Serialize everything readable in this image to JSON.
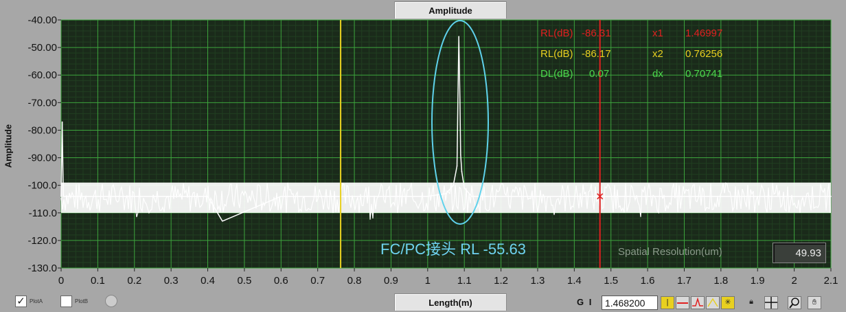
{
  "chart_data": {
    "type": "line",
    "title": "Amplitude",
    "xlabel": "Length(m)",
    "ylabel": "Amplitude",
    "xlim": [
      0,
      2.1
    ],
    "ylim": [
      -130,
      -40
    ],
    "x_ticks": [
      "0",
      "0.1",
      "0.2",
      "0.3",
      "0.4",
      "0.5",
      "0.6",
      "0.7",
      "0.8",
      "0.9",
      "1",
      "1.1",
      "1.2",
      "1.3",
      "1.4",
      "1.5",
      "1.6",
      "1.7",
      "1.8",
      "1.9",
      "2",
      "2.1"
    ],
    "x_tick_values": [
      0,
      0.1,
      0.2,
      0.3,
      0.4,
      0.5,
      0.6,
      0.7,
      0.8,
      0.9,
      1.0,
      1.1,
      1.2,
      1.3,
      1.4,
      1.5,
      1.6,
      1.7,
      1.8,
      1.9,
      2.0,
      2.1
    ],
    "y_ticks": [
      "-40.00",
      "-50.00",
      "-60.00",
      "-70.00",
      "-80.00",
      "-90.00",
      "-100.0",
      "-110.0",
      "-120.0",
      "-130.0"
    ],
    "y_tick_values": [
      -40,
      -50,
      -60,
      -70,
      -80,
      -90,
      -100,
      -110,
      -120,
      -130
    ],
    "grid": true,
    "series": [
      {
        "name": "PlotA",
        "color": "#ffffff",
        "x": [
          0,
          0.003,
          0.006,
          0.2,
          0.4,
          0.44,
          0.6,
          0.76,
          0.9,
          1.0,
          1.05,
          1.07,
          1.08,
          1.085,
          1.088,
          1.09,
          1.093,
          1.1,
          1.12,
          1.2,
          1.4,
          1.47,
          1.6,
          1.8,
          2.0,
          2.1
        ],
        "y": [
          -104,
          -77,
          -104,
          -104,
          -104,
          -113,
          -104,
          -104,
          -104,
          -104,
          -103,
          -100,
          -93,
          -46,
          -69,
          -89,
          -95,
          -101,
          -104,
          -104,
          -104,
          -104,
          -104,
          -104,
          -104,
          -104
        ],
        "noise_band": [
          -110,
          -99
        ]
      }
    ],
    "cursors": [
      {
        "name": "x1",
        "x": 1.46997,
        "color": "#e02020"
      },
      {
        "name": "x2",
        "x": 0.76256,
        "color": "#e8d020"
      }
    ],
    "annotations": [
      "FC/PC接头 RL -55.63"
    ]
  },
  "readouts": {
    "rl1_label": "RL(dB)",
    "rl1_value": "-86.31",
    "x1_label": "x1",
    "x1_value": "1.46997",
    "rl2_label": "RL(dB)",
    "rl2_value": "-86.17",
    "x2_label": "x2",
    "x2_value": "0.76256",
    "dl_label": "DL(dB)",
    "dl_value": "0.07",
    "dx_label": "dx",
    "dx_value": "0.70741"
  },
  "annotation": "FC/PC接头 RL -55.63",
  "spatial_resolution": {
    "label": "Spatial Resolution(um)",
    "value": "49.93"
  },
  "legend": {
    "plot_a": "PlotA",
    "plot_b": "PlotB"
  },
  "cursor_panel": {
    "label": "G I",
    "value": "1.468200"
  },
  "colors": {
    "plot_bg": "#1a2a1a",
    "grid_major": "#3da53d",
    "grid_minor": "#213f21",
    "trace": "#ffffff",
    "cursor_x1": "#e02020",
    "cursor_x2": "#e8d020",
    "dl_text": "#4cd64c",
    "ellipse": "#5fd2ec"
  }
}
